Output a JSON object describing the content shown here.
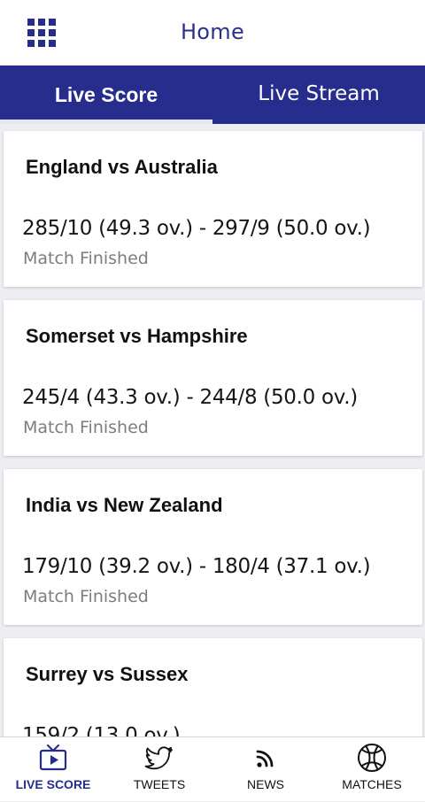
{
  "header": {
    "title": "Home",
    "menu_icon": "grid-menu-icon"
  },
  "tabs": [
    {
      "label": "Live Score",
      "active": true
    },
    {
      "label": "Live Stream",
      "active": false
    }
  ],
  "matches": [
    {
      "title": "England vs Australia",
      "score": "285/10 (49.3 ov.) - 297/9 (50.0 ov.)",
      "status": "Match Finished"
    },
    {
      "title": "Somerset vs Hampshire",
      "score": "245/4 (43.3 ov.) - 244/8 (50.0 ov.)",
      "status": "Match Finished"
    },
    {
      "title": "India vs New Zealand",
      "score": "179/10 (39.2 ov.) - 180/4 (37.1 ov.)",
      "status": "Match Finished"
    },
    {
      "title": "Surrey vs Sussex",
      "score": "159/2 (13.0 ov.)",
      "status": ""
    }
  ],
  "bottom_nav": [
    {
      "label": "LIVE SCORE",
      "icon": "tv-play-icon",
      "active": true
    },
    {
      "label": "TWEETS",
      "icon": "twitter-bird-icon",
      "active": false
    },
    {
      "label": "NEWS",
      "icon": "rss-feed-icon",
      "active": false
    },
    {
      "label": "MATCHES",
      "icon": "ball-icon",
      "active": false
    }
  ],
  "colors": {
    "primary": "#262d8c",
    "header_title": "#2a3187",
    "background": "#eceef3",
    "status_text": "#7d7d7d"
  }
}
